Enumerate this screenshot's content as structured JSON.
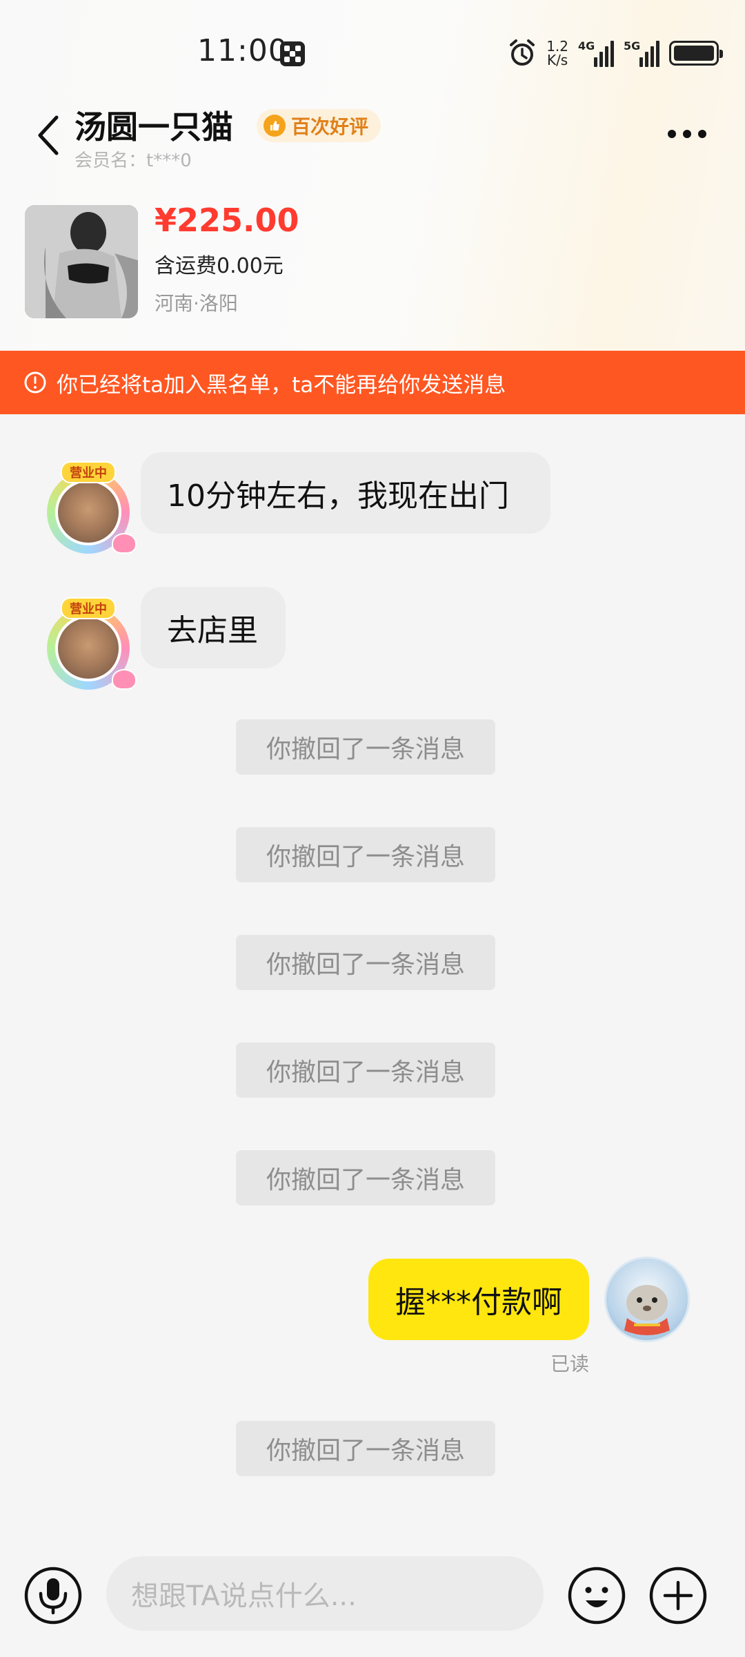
{
  "status_bar": {
    "time": "11:00",
    "net_speed_value": "1.2",
    "net_speed_unit": "K/s",
    "sig1": "4G",
    "sig2": "5G"
  },
  "header": {
    "name": "汤圆一只猫",
    "badge": "百次好评",
    "member": "会员名：t***0"
  },
  "product": {
    "price": "¥225.00",
    "shipping": "含运费0.00元",
    "location": "河南·洛阳"
  },
  "warning": {
    "text": "你已经将ta加入黑名单，ta不能再给你发送消息"
  },
  "avatar_tag": "营业中",
  "messages": {
    "in1": "10分钟左右，我现在出门",
    "in2": "去店里",
    "recall": "你撤回了一条消息",
    "out1": "握***付款啊",
    "read": "已读"
  },
  "input": {
    "placeholder": "想跟TA说点什么..."
  },
  "colors": {
    "warning": "#ff5722",
    "price": "#ff3b30",
    "out_bubble": "#ffe60f",
    "badge": "#f5a31a"
  }
}
